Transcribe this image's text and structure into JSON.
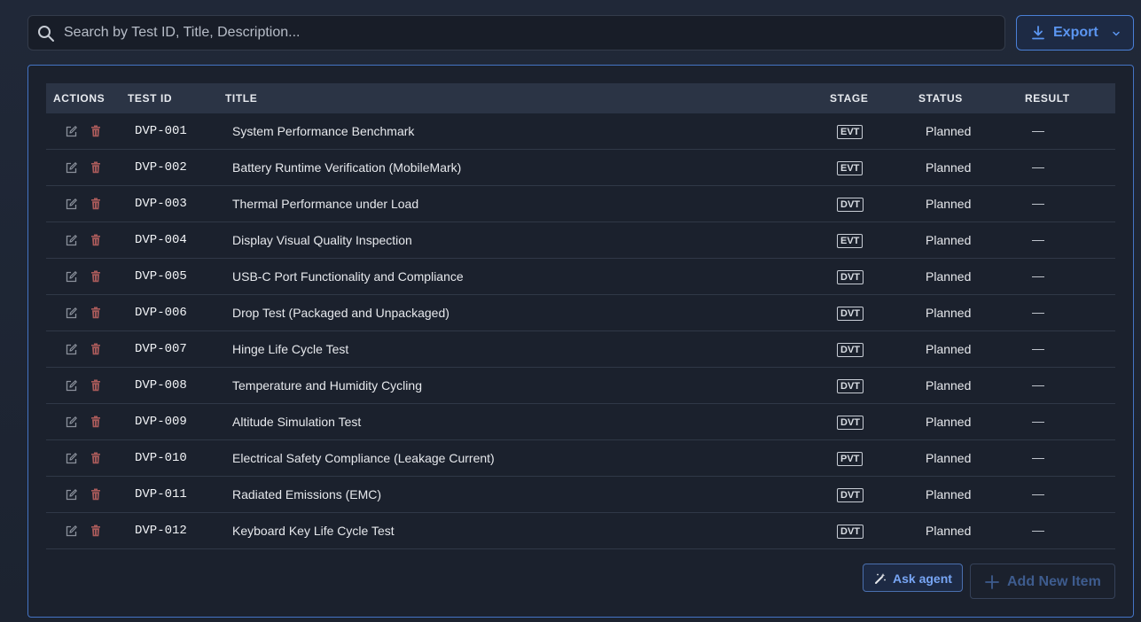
{
  "search": {
    "placeholder": "Search by Test ID, Title, Description..."
  },
  "toolbar": {
    "export_label": "Export"
  },
  "table": {
    "headers": {
      "actions": "ACTIONS",
      "test_id": "TEST ID",
      "title": "TITLE",
      "stage": "STAGE",
      "status": "STATUS",
      "result": "RESULT"
    },
    "rows": [
      {
        "id": "DVP-001",
        "title": "System Performance Benchmark",
        "stage": "EVT",
        "status": "Planned",
        "result": "—"
      },
      {
        "id": "DVP-002",
        "title": "Battery Runtime Verification (MobileMark)",
        "stage": "EVT",
        "status": "Planned",
        "result": "—"
      },
      {
        "id": "DVP-003",
        "title": "Thermal Performance under Load",
        "stage": "DVT",
        "status": "Planned",
        "result": "—"
      },
      {
        "id": "DVP-004",
        "title": "Display Visual Quality Inspection",
        "stage": "EVT",
        "status": "Planned",
        "result": "—"
      },
      {
        "id": "DVP-005",
        "title": "USB-C Port Functionality and Compliance",
        "stage": "DVT",
        "status": "Planned",
        "result": "—"
      },
      {
        "id": "DVP-006",
        "title": "Drop Test (Packaged and Unpackaged)",
        "stage": "DVT",
        "status": "Planned",
        "result": "—"
      },
      {
        "id": "DVP-007",
        "title": "Hinge Life Cycle Test",
        "stage": "DVT",
        "status": "Planned",
        "result": "—"
      },
      {
        "id": "DVP-008",
        "title": "Temperature and Humidity Cycling",
        "stage": "DVT",
        "status": "Planned",
        "result": "—"
      },
      {
        "id": "DVP-009",
        "title": "Altitude Simulation Test",
        "stage": "DVT",
        "status": "Planned",
        "result": "—"
      },
      {
        "id": "DVP-010",
        "title": "Electrical Safety Compliance (Leakage Current)",
        "stage": "PVT",
        "status": "Planned",
        "result": "—"
      },
      {
        "id": "DVP-011",
        "title": "Radiated Emissions (EMC)",
        "stage": "DVT",
        "status": "Planned",
        "result": "—"
      },
      {
        "id": "DVP-012",
        "title": "Keyboard Key Life Cycle Test",
        "stage": "DVT",
        "status": "Planned",
        "result": "—"
      }
    ]
  },
  "footer": {
    "ask_label": "Ask agent",
    "add_label": "Add New Item"
  },
  "icons": {
    "search": "search-icon",
    "export": "download-icon",
    "chevron": "chevron-down-icon",
    "edit": "edit-icon",
    "delete": "trash-icon",
    "ask": "magic-wand-icon",
    "add": "plus-icon"
  },
  "colors": {
    "accent": "#5b95f0",
    "panel_border": "#4474c4",
    "delete_icon": "#a85a5a"
  }
}
